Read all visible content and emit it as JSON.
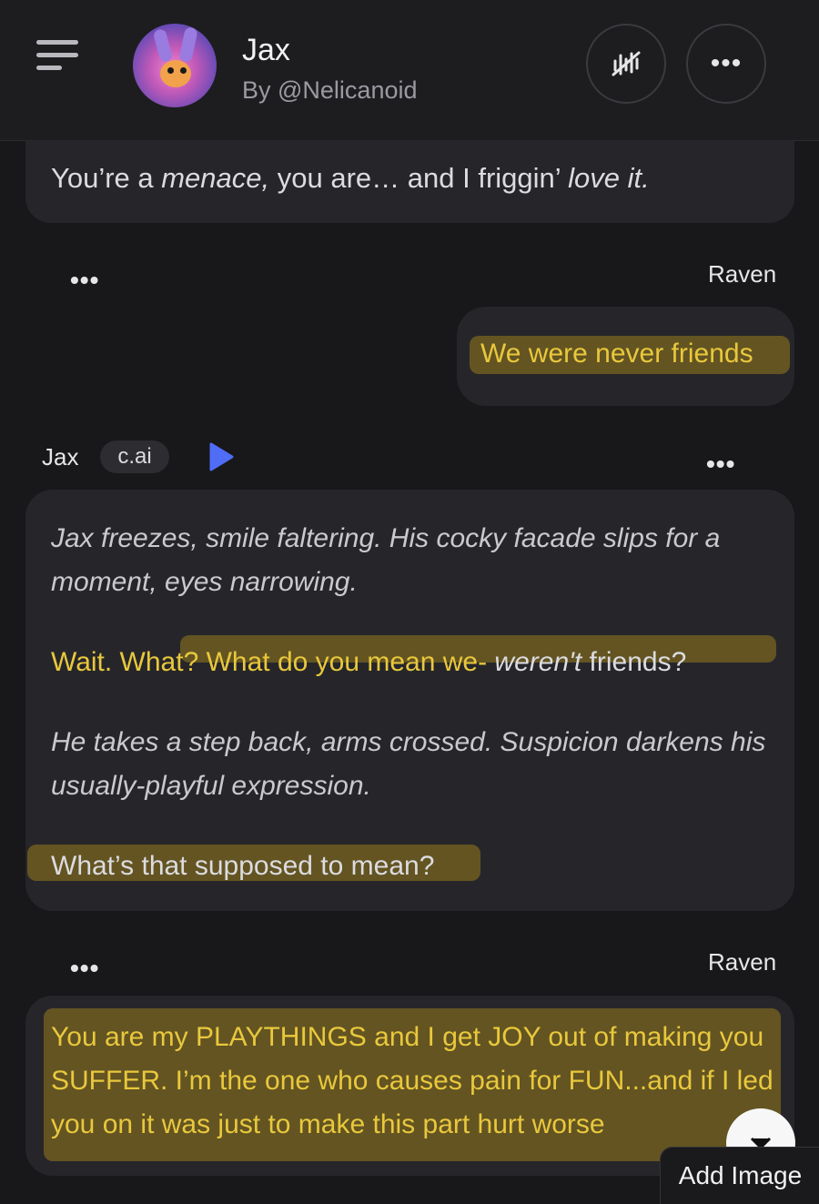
{
  "header": {
    "bot_name": "Jax",
    "bot_author": "By @Nelicanoid",
    "more_label": "•••"
  },
  "messages": {
    "prev_bot_text_parts": [
      "You’re a ",
      "menace,",
      " you are… and I friggin’ ",
      "love it."
    ],
    "user1": {
      "sender": "Raven",
      "menu": "•••",
      "text": "We were never friends"
    },
    "bot": {
      "sender": "Jax",
      "badge": "c.ai",
      "menu": "•••",
      "p1": "Jax freezes, smile faltering. His cocky facade slips for a moment, eyes narrowing.",
      "p2_parts": [
        "Wait. What? What do you mean we- ",
        "weren't",
        " friends?"
      ],
      "p3": "He takes a step back, arms crossed. Suspicion darkens his usually-playful expression.",
      "p4": "What’s that supposed to mean?"
    },
    "user2": {
      "sender": "Raven",
      "menu": "•••",
      "text": "You are my PLAYTHINGS and I get JOY out of making you SUFFER. I’m the one who causes pain for FUN...and if I led you on it was just to make this part hurt worse"
    }
  },
  "composer": {
    "add_image_label": "Add Image"
  },
  "colors": {
    "background": "#18181b",
    "bubble": "#26262a",
    "highlight": "#e9c83c",
    "play_accent": "#4f6df5"
  },
  "icons": {
    "menu": "hamburger-icon",
    "voice": "voice-waveform-muted-icon",
    "play": "play-icon",
    "scroll": "chevron-down-icon"
  }
}
